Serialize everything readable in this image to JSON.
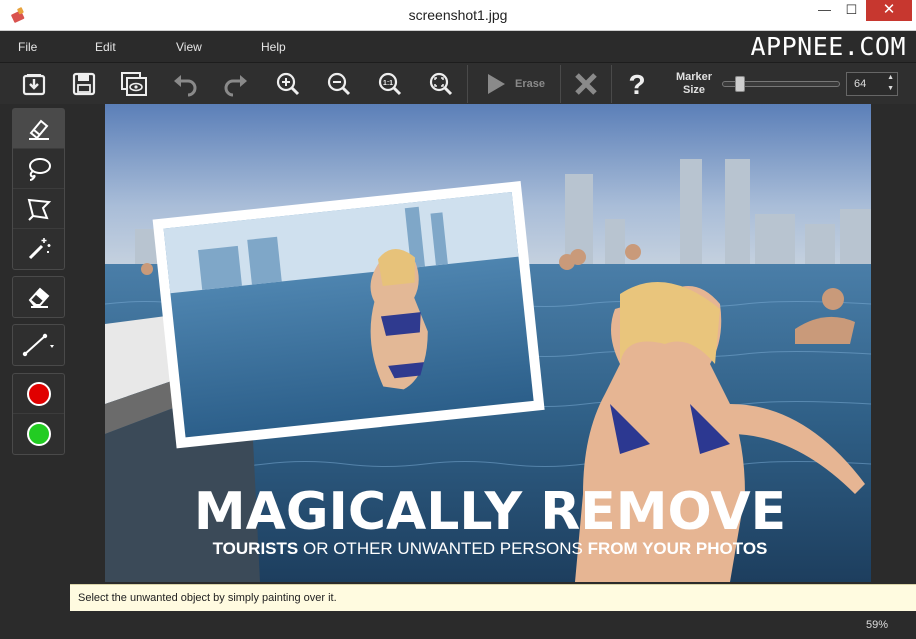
{
  "window": {
    "title": "screenshot1.jpg",
    "minimize": "—",
    "maximize": "☐",
    "close": "✕"
  },
  "menu": {
    "file": "File",
    "edit": "Edit",
    "view": "View",
    "help": "Help"
  },
  "watermark": "APPNEE.COM",
  "toolbar": {
    "buttons": [
      "open-icon",
      "save-icon",
      "save-as-icon",
      "undo-icon",
      "redo-icon",
      "zoom-in-icon",
      "zoom-out-icon",
      "zoom-actual-icon",
      "zoom-fit-icon",
      "erase-play-icon",
      "cancel-icon",
      "help-icon"
    ],
    "zoom_actual_label": "1:1",
    "erase_label": "Erase",
    "marker_label_line1": "Marker",
    "marker_label_line2": "Size",
    "marker_value": "64",
    "marker_fraction": 0.12
  },
  "tools": [
    "marker-icon",
    "lasso-icon",
    "polygonal-lasso-icon",
    "magic-wand-icon",
    "eraser-icon",
    "line-icon",
    "red-color",
    "green-color"
  ],
  "colors": {
    "red": "#e00000",
    "green": "#22cc22",
    "accent": "#c7372f"
  },
  "photo": {
    "headline": "MAGICALLY REMOVE",
    "sub_bold_1": "TOURISTS",
    "sub_normal": "OR OTHER UNWANTED PERSONS",
    "sub_bold_2": "FROM YOUR PHOTOS"
  },
  "hint": "Select the unwanted object by simply painting over it.",
  "zoom": "59%"
}
